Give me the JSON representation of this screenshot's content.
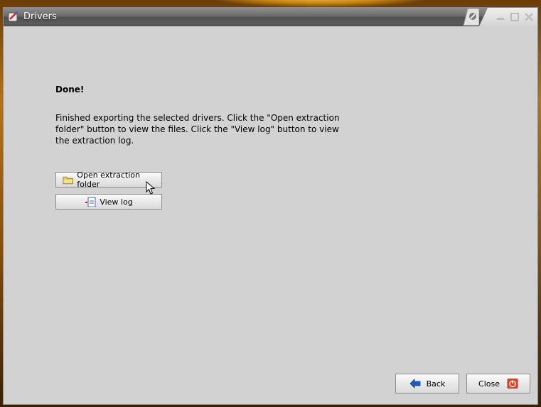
{
  "window": {
    "title": "Drivers",
    "controls": {
      "minimize_icon": "minimize-icon",
      "maximize_icon": "maximize-icon",
      "close_icon": "close-icon"
    }
  },
  "content": {
    "heading": "Done!",
    "message": "Finished exporting the selected drivers. Click the \"Open extraction folder\" button to view the files. Click the \"View log\" button to view the extraction log.",
    "buttons": {
      "open_folder": "Open extraction folder",
      "view_log": "View log"
    }
  },
  "footer": {
    "back_label": "Back",
    "close_label": "Close"
  },
  "colors": {
    "window_bg": "#d2d2d2",
    "titlebar": "#5e5e5e",
    "back_arrow": "#1f5fb8",
    "close_badge": "#e0442b"
  }
}
